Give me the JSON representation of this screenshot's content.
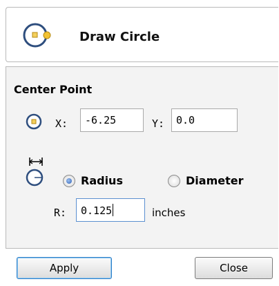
{
  "header": {
    "title": "Draw Circle",
    "icon": "draw-circle-icon"
  },
  "center_point": {
    "title": "Center Point",
    "icon": "center-point-icon",
    "x_label": "X:",
    "x_value": "-6.25",
    "y_label": "Y:",
    "y_value": "0.0"
  },
  "size": {
    "icon": "radius-measure-icon",
    "radius_label": "Radius",
    "diameter_label": "Diameter",
    "selected": "Radius",
    "r_label": "R:",
    "r_value": "0.125",
    "units": "inches"
  },
  "buttons": {
    "apply": "Apply",
    "close": "Close"
  },
  "colors": {
    "accent_orange": "#d9a21a",
    "icon_blue": "#2e4e7e",
    "radio_blue": "#2d5fb5",
    "apply_focus": "#2f7fc7"
  }
}
